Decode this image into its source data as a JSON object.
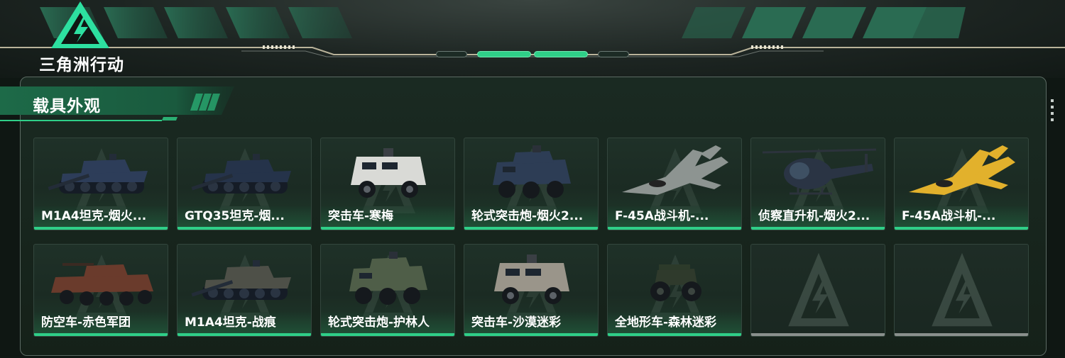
{
  "game": {
    "logo_text": "三角洲行动",
    "logo_icon": "delta-triangle-lightning-icon"
  },
  "section": {
    "title": "载具外观"
  },
  "colors": {
    "accent": "#2fcf88",
    "empty_underline": "#8a908d",
    "panel_border": "#5c6b64"
  },
  "skins": [
    {
      "label": "M1A4坦克-烟火...",
      "icon": "tank-icon",
      "status": "owned"
    },
    {
      "label": "GTQ35坦克-烟...",
      "icon": "tank-icon",
      "status": "owned"
    },
    {
      "label": "突击车-寒梅",
      "icon": "armored-car-icon",
      "status": "owned"
    },
    {
      "label": "轮式突击炮-烟火2...",
      "icon": "wheeled-assault-gun-icon",
      "status": "owned"
    },
    {
      "label": "F-45A战斗机-...",
      "icon": "fighter-jet-icon",
      "status": "owned"
    },
    {
      "label": "侦察直升机-烟火2...",
      "icon": "helicopter-icon",
      "status": "owned"
    },
    {
      "label": "F-45A战斗机-...",
      "icon": "fighter-jet-icon",
      "status": "owned"
    },
    {
      "label": "防空车-赤色军团",
      "icon": "aa-vehicle-icon",
      "status": "owned"
    },
    {
      "label": "M1A4坦克-战痕",
      "icon": "tank-icon",
      "status": "owned"
    },
    {
      "label": "轮式突击炮-护林人",
      "icon": "wheeled-assault-gun-icon",
      "status": "owned"
    },
    {
      "label": "突击车-沙漠迷彩",
      "icon": "armored-car-icon",
      "status": "owned"
    },
    {
      "label": "全地形车-森林迷彩",
      "icon": "atv-icon",
      "status": "owned"
    },
    {
      "label": "",
      "icon": "delta-logo-placeholder-icon",
      "status": "empty"
    },
    {
      "label": "",
      "icon": "delta-logo-placeholder-icon",
      "status": "empty"
    }
  ]
}
